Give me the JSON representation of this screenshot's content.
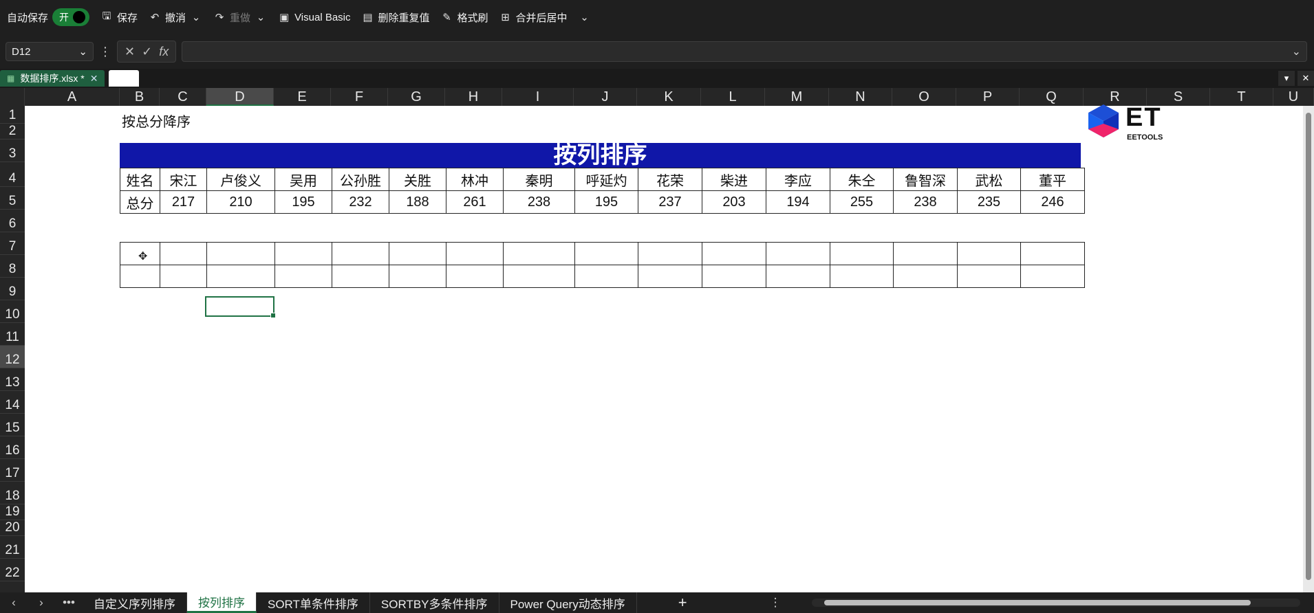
{
  "qat": {
    "autosave_label": "自动保存",
    "autosave_state": "开",
    "save": "保存",
    "undo": "撤消",
    "redo": "重做",
    "vb": "Visual Basic",
    "dedupe": "删除重复值",
    "format_painter": "格式刷",
    "merge_center": "合并后居中"
  },
  "formula": {
    "name_box": "D12",
    "fx": "fx"
  },
  "file_tab": {
    "name": "数据排序.xlsx *"
  },
  "columns": [
    "A",
    "B",
    "C",
    "D",
    "E",
    "F",
    "G",
    "H",
    "I",
    "J",
    "K",
    "L",
    "M",
    "N",
    "O",
    "P",
    "Q",
    "R",
    "S",
    "T",
    "U"
  ],
  "rows": [
    "1",
    "2",
    "3",
    "4",
    "5",
    "6",
    "7",
    "8",
    "9",
    "10",
    "11",
    "12",
    "13",
    "14",
    "15",
    "16",
    "17",
    "18",
    "19",
    "20",
    "21",
    "22"
  ],
  "sheet": {
    "note": "按总分降序",
    "banner": "按列排序",
    "header_row": [
      "姓名",
      "宋江",
      "卢俊义",
      "吴用",
      "公孙胜",
      "关胜",
      "林冲",
      "秦明",
      "呼延灼",
      "花荣",
      "柴进",
      "李应",
      "朱仝",
      "鲁智深",
      "武松",
      "董平"
    ],
    "score_row": [
      "总分",
      "217",
      "210",
      "195",
      "232",
      "188",
      "261",
      "238",
      "195",
      "237",
      "203",
      "194",
      "255",
      "238",
      "235",
      "246"
    ],
    "logo_text": "ET",
    "logo_sub": "EETOOLS"
  },
  "sheet_tabs": [
    "自定义序列排序",
    "按列排序",
    "SORT单条件排序",
    "SORTBY多条件排序",
    "Power Query动态排序"
  ],
  "active_tab": "按列排序",
  "colors": {
    "banner": "#1017a8",
    "accent": "#1f7244",
    "chrome": "#1f1f1f"
  }
}
